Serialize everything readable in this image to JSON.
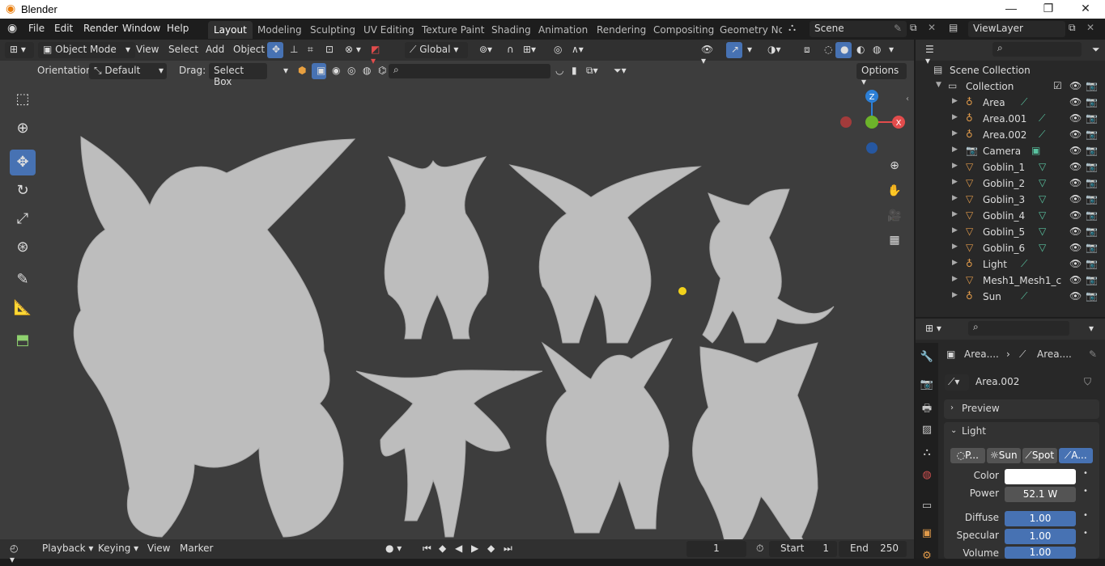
{
  "window": {
    "title": "Blender",
    "minimize": "—",
    "restore": "❐",
    "close": "✕"
  },
  "menu": {
    "file": "File",
    "edit": "Edit",
    "render": "Render",
    "window": "Window",
    "help": "Help"
  },
  "workspaces": [
    "Layout",
    "Modeling",
    "Sculpting",
    "UV Editing",
    "Texture Paint",
    "Shading",
    "Animation",
    "Rendering",
    "Compositing",
    "Geometry Noc"
  ],
  "scene": {
    "name": "Scene",
    "view_layer": "ViewLayer"
  },
  "viewport_header": {
    "mode": "Object Mode",
    "view": "View",
    "select": "Select",
    "add": "Add",
    "object": "Object",
    "transform_orientation": "Global"
  },
  "tool_header": {
    "orientation_label": "Orientation:",
    "orientation_value": "Default",
    "drag_label": "Drag:",
    "drag_value": "Select Box",
    "options": "Options"
  },
  "outliner": {
    "scene_collection": "Scene Collection",
    "collection": "Collection",
    "items": [
      {
        "name": "Area",
        "type": "light"
      },
      {
        "name": "Area.001",
        "type": "light"
      },
      {
        "name": "Area.002",
        "type": "light"
      },
      {
        "name": "Camera",
        "type": "camera"
      },
      {
        "name": "Goblin_1",
        "type": "mesh"
      },
      {
        "name": "Goblin_2",
        "type": "mesh"
      },
      {
        "name": "Goblin_3",
        "type": "mesh"
      },
      {
        "name": "Goblin_4",
        "type": "mesh"
      },
      {
        "name": "Goblin_5",
        "type": "mesh"
      },
      {
        "name": "Goblin_6",
        "type": "mesh"
      },
      {
        "name": "Light",
        "type": "light"
      },
      {
        "name": "Mesh1_Mesh1_c",
        "type": "mesh"
      },
      {
        "name": "Sun",
        "type": "light"
      }
    ]
  },
  "properties": {
    "breadcrumb_1": "Area....",
    "breadcrumb_2": "Area....",
    "datablock": "Area.002",
    "preview_panel": "Preview",
    "light_panel": "Light",
    "light_types": [
      "P...",
      "Sun",
      "Spot",
      "A..."
    ],
    "color_label": "Color",
    "power_label": "Power",
    "power_value": "52.1 W",
    "diffuse_label": "Diffuse",
    "diffuse_value": "1.00",
    "specular_label": "Specular",
    "specular_value": "1.00",
    "volume_label": "Volume",
    "volume_value": "1.00",
    "light_color": "#ffffff"
  },
  "timeline": {
    "playback": "Playback",
    "keying": "Keying",
    "view": "View",
    "marker": "Marker",
    "current_frame": "1",
    "start_label": "Start",
    "start_value": "1",
    "end_label": "End",
    "end_value": "250"
  },
  "gizmo": {
    "z": "Z",
    "x": "X"
  },
  "colors": {
    "accent": "#4772b3",
    "x_axis": "#e24c4c",
    "y_axis": "#6cb32a",
    "z_axis": "#2c7fd6",
    "viewport_bg": "#3d3d3d"
  }
}
